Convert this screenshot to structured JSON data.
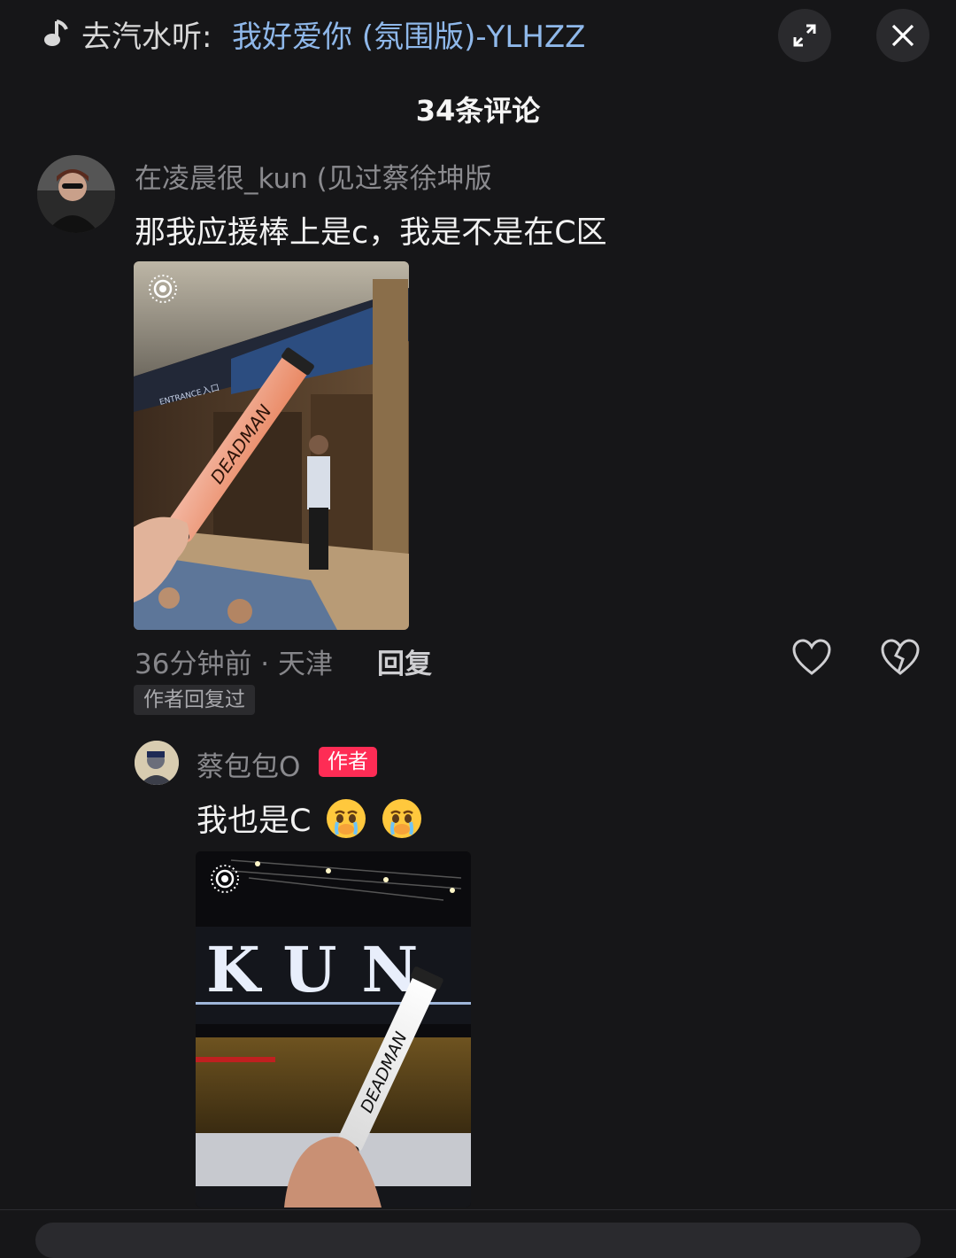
{
  "header": {
    "music_prefix": "去汽水听:",
    "music_title": "我好爱你 (氛围版)-YLHZZ",
    "music_icon": "music-note-icon",
    "expand_icon": "expand-icon",
    "close_icon": "close-icon"
  },
  "comment_count": "34条评论",
  "comments": [
    {
      "username": "在凌晨很_kun (见过蔡徐坤版",
      "text": "那我应援棒上是c，我是不是在C区",
      "meta": "36分钟前 · 天津",
      "reply_label": "回复",
      "replied_badge": "作者回复过",
      "photo_texts": [
        "DEADMAN",
        "ENTRANCE",
        "入口"
      ],
      "replies": [
        {
          "username": "蔡包包O",
          "author_tag": "作者",
          "text": "我也是C",
          "emojis": [
            "crying-face-emoji",
            "crying-face-emoji"
          ],
          "photo_texts": [
            "KUN",
            "DEADMAN"
          ]
        }
      ]
    }
  ],
  "colors": {
    "background": "#161618",
    "link_blue": "#8fb8ea",
    "author_tag": "#fe2c55"
  }
}
